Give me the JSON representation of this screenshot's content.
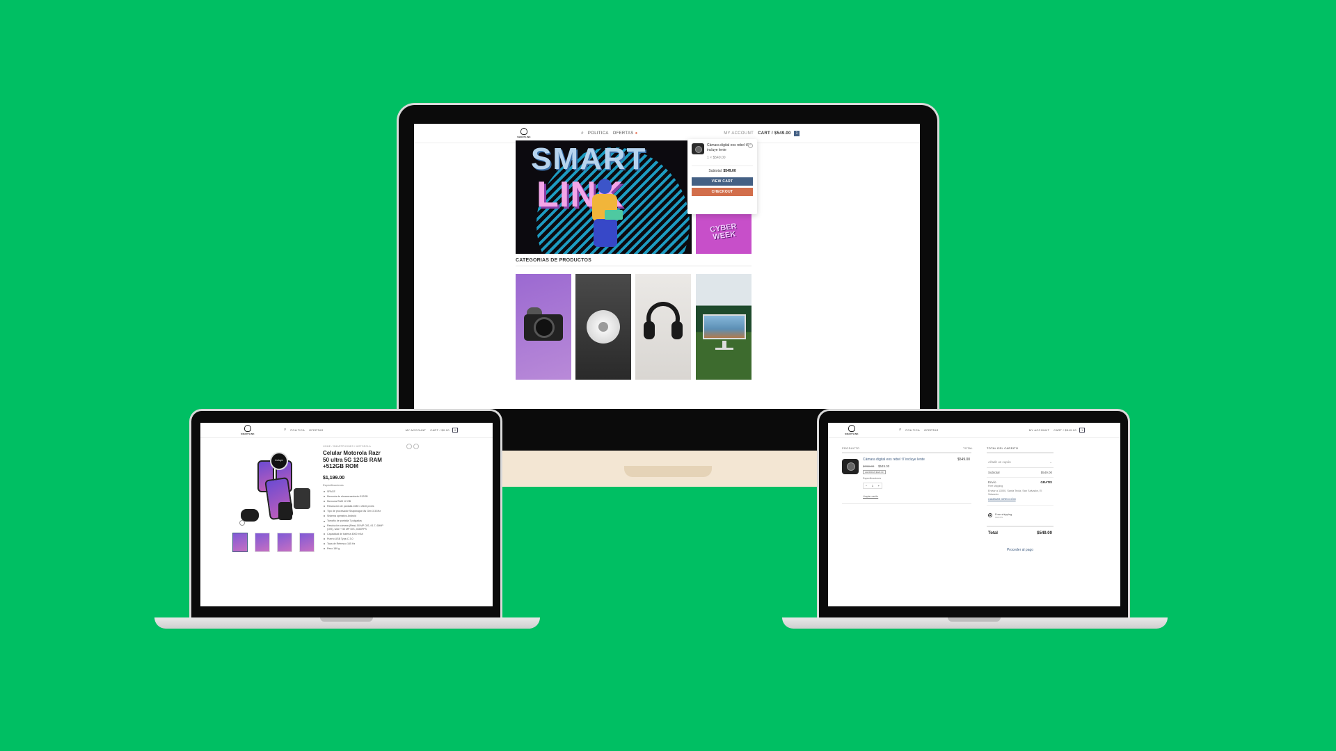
{
  "brand": {
    "logo_text": "SMARTLINK"
  },
  "header": {
    "nav_politica": "POLITICA",
    "nav_ofertas": "OFERTAS",
    "my_account": "MY ACCOUNT",
    "cart_label": "CART / $549.00",
    "cart_count": "1"
  },
  "header_left": {
    "cart_label": "CART / $0.00",
    "cart_count": "0"
  },
  "home": {
    "hero_line1": "SMART",
    "hero_line2": "LINK",
    "cyber_line1": "CYBER",
    "cyber_line2": "WEEK",
    "categories_title": "CATEGORIAS DE PRODUCTOS",
    "mini_cart": {
      "item_name": "Cámara digital eos rebel t7 incluye lente",
      "item_price": "1 × $549.00",
      "subtotal_label": "Subtotal:",
      "subtotal_value": "$549.00",
      "view_cart": "VIEW CART",
      "checkout": "CHECKOUT"
    }
  },
  "product": {
    "breadcrumb": "HOME / SMARTPHONES / MOTOROLA",
    "title": "Celular Motorola Razr 50 ultra 5G 12GB RAM +512GB ROM",
    "price": "$1,199.00",
    "spec_head": "Especificaciones",
    "badge": "Incluye",
    "specs": [
      "SPACE",
      "Memoria de almacenamiento 512GB",
      "Memoria RAM 12 GB",
      "Resolución de pantalla 1080 x 2640 píxels",
      "Tipo de procesador Snapdragon 8s Gen 3 3GHz",
      "Sistema operativo Android",
      "Tamaño de pantalla 7 pulgadas",
      "Resolución cámara (Rear) 50 MP OIS, f/1.7, 60MP (OIS), wide + 50 MP OIS, 4K60FPS",
      "Capacidad de batería 4000 mAh",
      "Puerto USB Type-C 3.0",
      "Tasa de Refresco 165 Hz",
      "Peso 189 g"
    ]
  },
  "cart": {
    "col_product": "PRODUCTO",
    "col_total": "TOTAL",
    "item_name": "Cámara digital eos rebel t7 incluye lente",
    "old_price": "$769.00",
    "new_price": "$549.00",
    "save_badge": "AHORRAS $220.00",
    "spec_link": "Especificaciones",
    "qty": "1",
    "clear_cart": "Limpiar carrito",
    "row_total": "$549.00",
    "totals_head": "TOTAL DEL CARRITO",
    "coupon_placeholder": "Añadir un cupón",
    "subtotal_label": "Subtotal",
    "subtotal_value": "$549.00",
    "shipping_label": "Envío",
    "shipping_value": "GRATIS",
    "shipping_note": "Free shipping",
    "address": "Enviar a 11000, Santa Tecla, San Salvador, El Salvador",
    "change_address": "CAMBIAR DIRECCIÓN",
    "option_name": "Free shipping",
    "option_value": "GRATIS",
    "total_label": "Total",
    "total_value": "$549.00",
    "proceed": "Proceder al pago"
  },
  "colors": {
    "background": "#00BF63",
    "primary": "#446084",
    "accent": "#D26E4B"
  },
  "icons": [
    "search-icon",
    "close-icon",
    "chevron-down-icon",
    "share-icon",
    "zoom-icon",
    "cart-icon"
  ]
}
